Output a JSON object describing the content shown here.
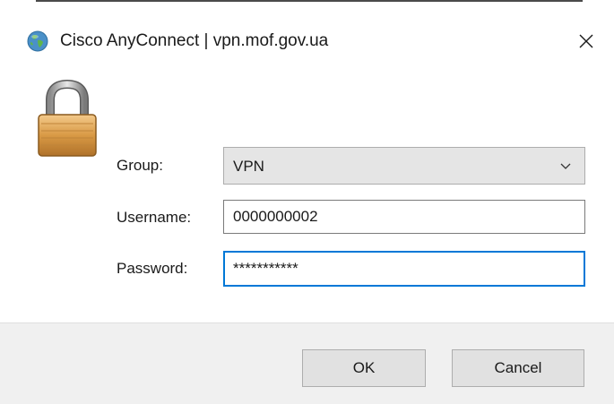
{
  "window": {
    "title": "Cisco AnyConnect | vpn.mof.gov.ua",
    "app_icon": "cisco-anyconnect-globe-icon",
    "close_icon": "close-icon"
  },
  "form": {
    "lock_icon": "padlock-icon",
    "group": {
      "label": "Group:",
      "value": "VPN",
      "dropdown_icon": "chevron-down-icon"
    },
    "username": {
      "label": "Username:",
      "value": "0000000002"
    },
    "password": {
      "label": "Password:",
      "value": "***********",
      "focused": true
    }
  },
  "buttons": {
    "ok_label": "OK",
    "cancel_label": "Cancel"
  },
  "colors": {
    "focus_border": "#0078d7",
    "footer_bg": "#f0f0f0",
    "button_bg": "#e1e1e1",
    "select_bg": "#e5e5e5"
  }
}
